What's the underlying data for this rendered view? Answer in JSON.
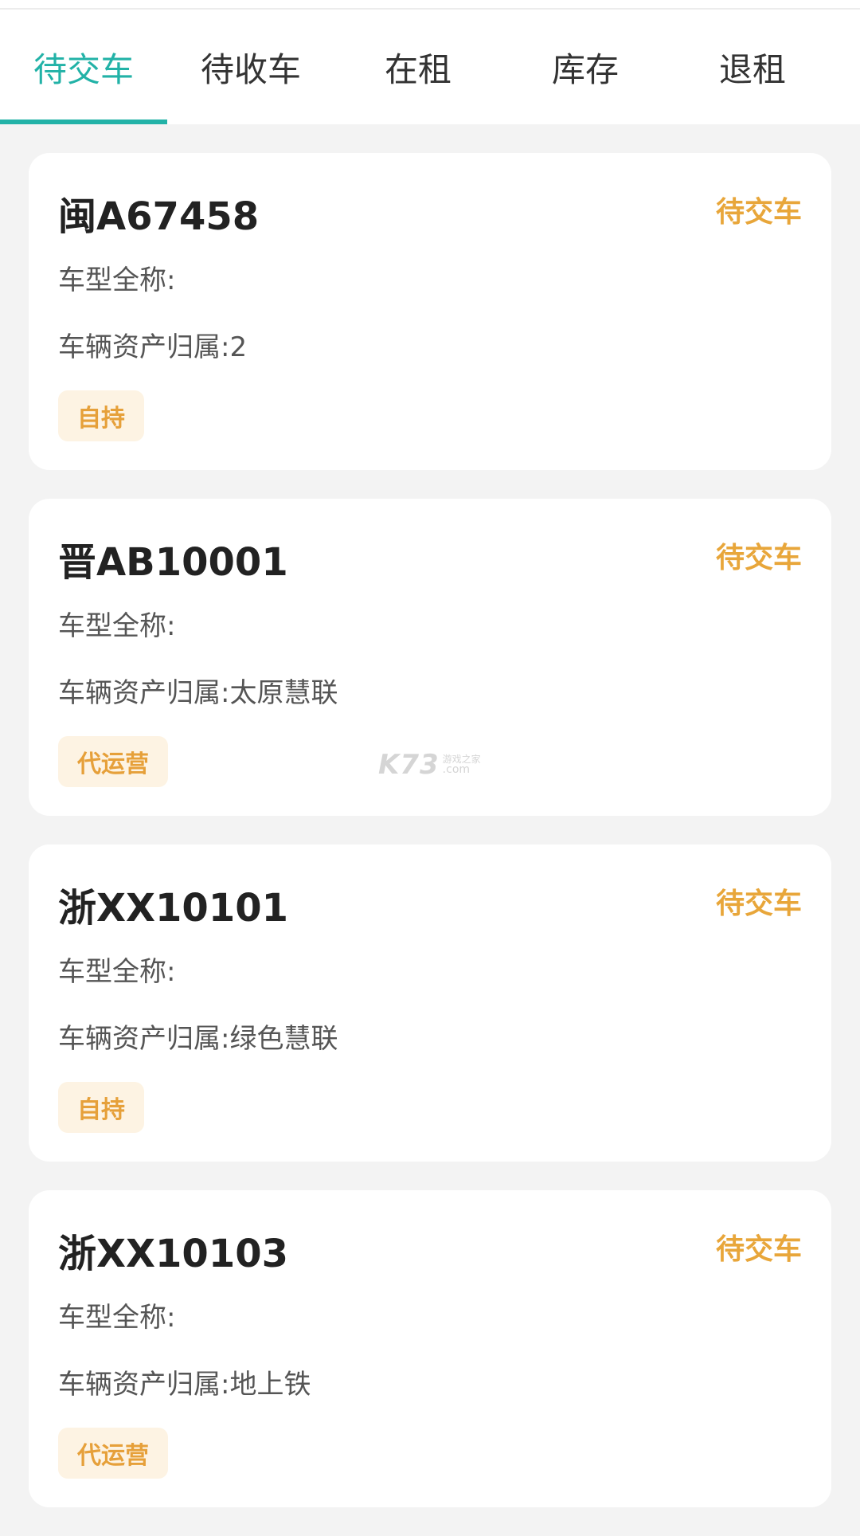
{
  "tabs": [
    {
      "label": "待交车",
      "active": true
    },
    {
      "label": "待收车",
      "active": false
    },
    {
      "label": "在租",
      "active": false
    },
    {
      "label": "库存",
      "active": false
    },
    {
      "label": "退租",
      "active": false
    }
  ],
  "vehicles": [
    {
      "plate": "闽A67458",
      "status": "待交车",
      "model": "车型全称:",
      "owner": "车辆资产归属:2",
      "tag": "自持"
    },
    {
      "plate": "晋AB10001",
      "status": "待交车",
      "model": "车型全称:",
      "owner": "车辆资产归属:太原慧联",
      "tag": "代运营"
    },
    {
      "plate": "浙XX10101",
      "status": "待交车",
      "model": "车型全称:",
      "owner": "车辆资产归属:绿色慧联",
      "tag": "自持"
    },
    {
      "plate": "浙XX10103",
      "status": "待交车",
      "model": "车型全称:",
      "owner": "车辆资产归属:地上铁",
      "tag": "代运营"
    }
  ],
  "watermark": {
    "main": "K73",
    "top": "游戏之家",
    "bottom": ".com"
  },
  "colors": {
    "accent": "#22b2a7",
    "status": "#e8a63a",
    "tag_bg": "#fdf3e3"
  }
}
